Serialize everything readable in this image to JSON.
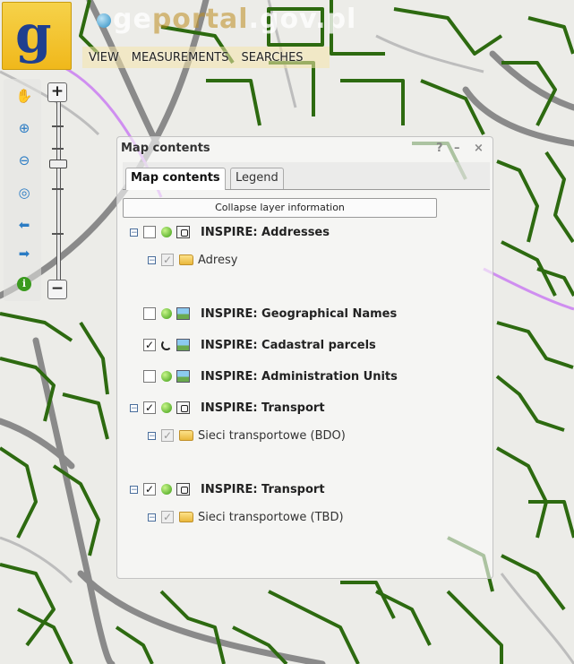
{
  "header": {
    "brand": {
      "pre": "ge",
      "accent": "portal",
      "post": ".gov.pl"
    },
    "menu": [
      {
        "label": "VIEW"
      },
      {
        "label": "MEASUREMENTS"
      },
      {
        "label": "SEARCHES"
      }
    ]
  },
  "panel": {
    "title": "Map contents",
    "help": "?",
    "minimize": "–",
    "close": "×",
    "tabs": [
      {
        "label": "Map contents",
        "active": true
      },
      {
        "label": "Legend",
        "active": false
      }
    ],
    "collapse_label": "Collapse layer information",
    "layers": [
      {
        "name": "INSPIRE: Addresses",
        "checked": false,
        "status": "ok",
        "icon": "legend-icon",
        "expandable": true
      },
      {
        "name": "Adresy",
        "sublayer": true
      },
      {
        "name": "INSPIRE: Geographical Names",
        "checked": false,
        "status": "ok",
        "icon": "image-icon",
        "expandable": false
      },
      {
        "name": "INSPIRE: Cadastral parcels",
        "checked": true,
        "status": "loading",
        "icon": "image-icon",
        "expandable": false
      },
      {
        "name": "INSPIRE: Administration Units",
        "checked": false,
        "status": "ok",
        "icon": "image-icon",
        "expandable": false
      },
      {
        "name": "INSPIRE: Transport",
        "checked": true,
        "status": "ok",
        "icon": "legend-icon",
        "expandable": true
      },
      {
        "name": "Sieci transportowe (BDO)",
        "sublayer": true
      },
      {
        "name": "INSPIRE: Transport",
        "checked": true,
        "status": "ok",
        "icon": "legend-icon",
        "expandable": true
      },
      {
        "name": "Sieci transportowe (TBD)",
        "sublayer": true
      }
    ]
  },
  "zoom": {
    "plus": "+",
    "minus": "−"
  },
  "colors": {
    "roads": "#2d6a10",
    "highway": "#7a7a7a",
    "boundary": "#cf8ef0",
    "logo": "#f0b81b"
  }
}
